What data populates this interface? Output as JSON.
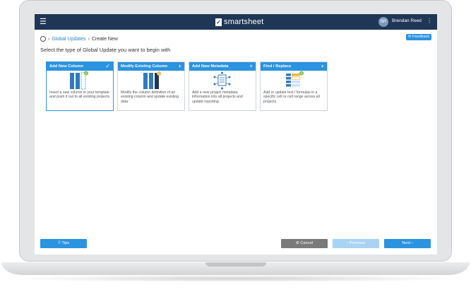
{
  "header": {
    "menu_icon": "hamburger-icon",
    "brand": "smartsheet",
    "user_initials": "BR",
    "user_name": "Brendan Reed",
    "more_icon": "kebab-icon"
  },
  "breadcrumb": {
    "root_icon": "person-icon",
    "link": "Global Updates",
    "current": "Create New"
  },
  "feedback_label": "Feedback",
  "instruction": "Select the type of Global Update you want to begin with",
  "cards": [
    {
      "title": "Add New Column",
      "description": "Insert a new column in your template and push it out to all existing projects",
      "state": "selected"
    },
    {
      "title": "Modify Existing Column",
      "description": "Modify the column definition of an existing column and update existing data",
      "state": "available"
    },
    {
      "title": "Add New Metadata",
      "description": "Add a new project metadata information into all projects and update reporting",
      "state": "available"
    },
    {
      "title": "Find / Replace",
      "description": "Add or update text / formulas in a specific cell or cell range across all projects",
      "state": "available"
    }
  ],
  "footer": {
    "tips": "Tips",
    "cancel": "Cancel",
    "previous": "Previous",
    "next": "Next"
  },
  "colors": {
    "topbar": "#1f3656",
    "accent": "#2b93e0",
    "cancel": "#7a7a7a",
    "previous_disabled": "#a9d3f3"
  }
}
